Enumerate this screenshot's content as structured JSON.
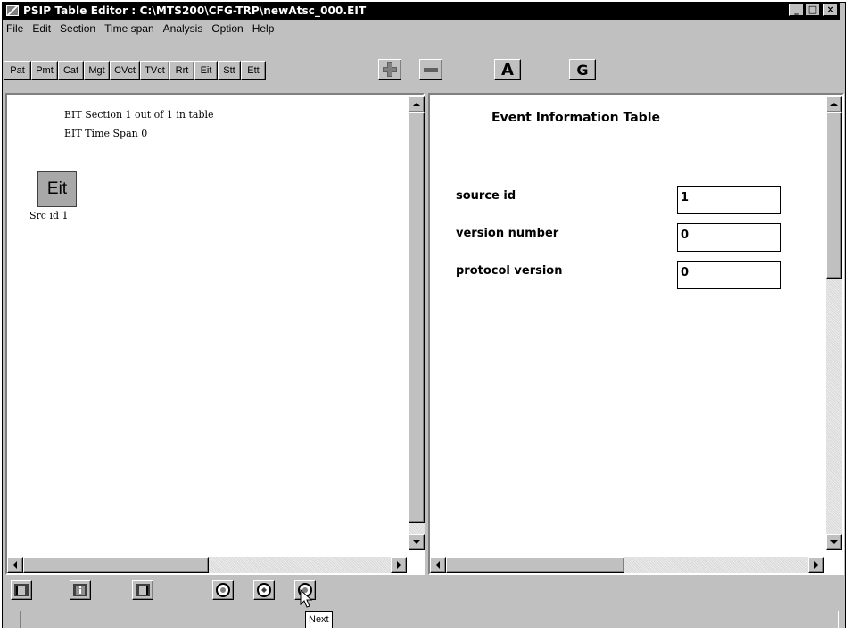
{
  "window": {
    "title": "PSIP Table Editor : C:\\MTS200\\CFG-TRP\\newAtsc_000.EIT",
    "controls": [
      "_",
      "□",
      "×"
    ]
  },
  "menu": [
    {
      "label": "File"
    },
    {
      "label": "Edit"
    },
    {
      "label": "Section"
    },
    {
      "label": "Time span"
    },
    {
      "label": "Analysis"
    },
    {
      "label": "Option"
    },
    {
      "label": "Help"
    }
  ],
  "toolbar": {
    "tables": [
      "Pat",
      "Pmt",
      "Cat",
      "Mgt",
      "CVct",
      "TVct",
      "Rrt",
      "Eit",
      "Stt",
      "Ett"
    ],
    "add_icon": "plus-icon",
    "remove_icon": "minus-icon",
    "a_label": "A",
    "g_label": "G"
  },
  "left_pane": {
    "line1": "EIT Section 1 out of 1 in table",
    "line2": "EIT Time Span 0",
    "node_label": "Eit",
    "node_caption": "Src id 1"
  },
  "right_pane": {
    "heading": "Event Information Table",
    "fields": [
      {
        "label": "source id",
        "value": "1"
      },
      {
        "label": "version number",
        "value": "0"
      },
      {
        "label": "protocol version",
        "value": "0"
      }
    ]
  },
  "bottom": {
    "tooltip": "Next"
  },
  "colors": {
    "titlebar": "#000000",
    "face": "#c0c0c0",
    "node": "#a8a8a8"
  }
}
